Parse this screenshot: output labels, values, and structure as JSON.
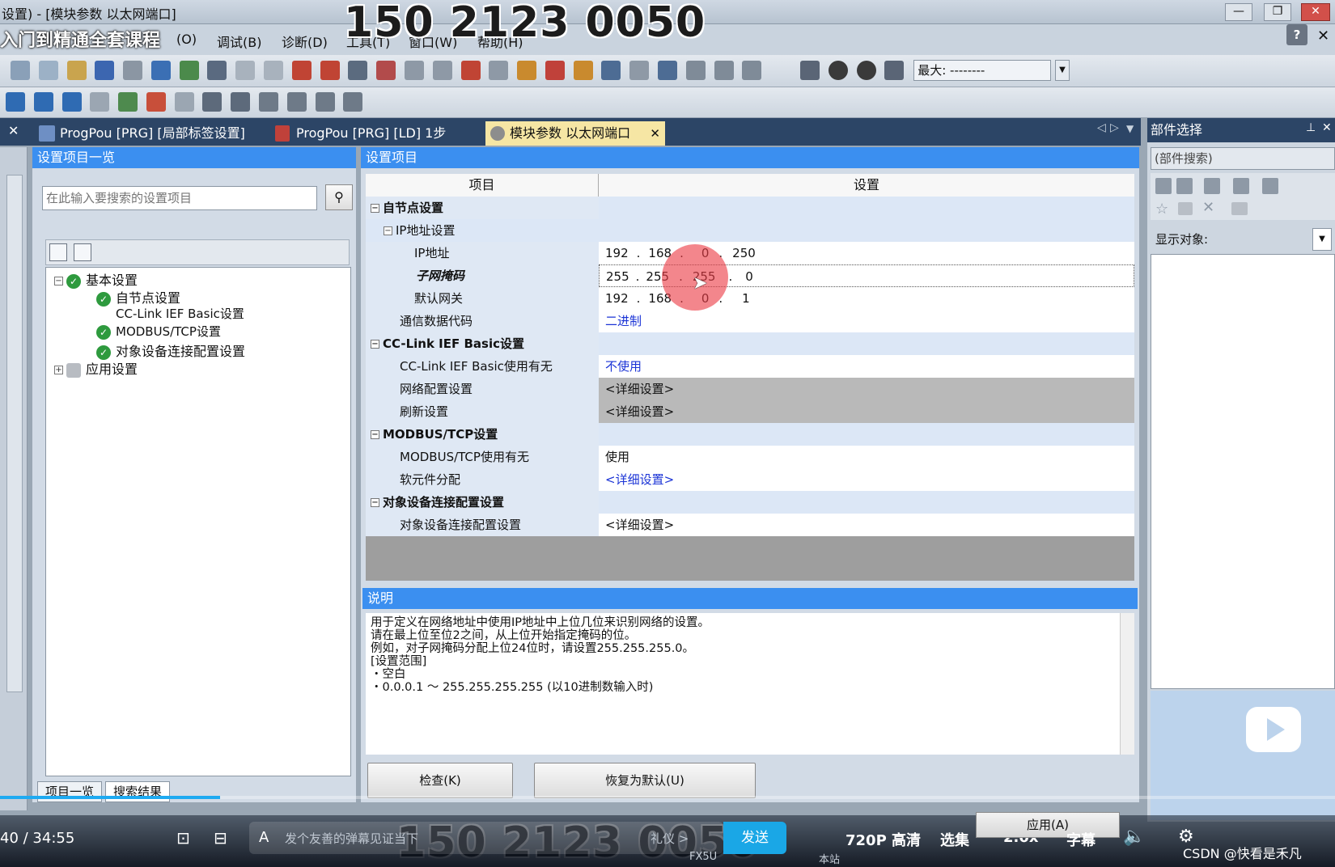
{
  "window": {
    "title": "设置) - [模块参数 以太网端口]",
    "course_overlay": "入门到精通全套课程",
    "watermark": "150 2123 0050"
  },
  "menu": {
    "items": [
      "(O)",
      "调试(B)",
      "诊断(D)",
      "工具(T)",
      "窗口(W)",
      "帮助(H)"
    ]
  },
  "toolbar": {
    "zoom_label": "最大: --------"
  },
  "tabs": [
    {
      "label": "ProgPou [PRG] [局部标签设置]"
    },
    {
      "label": "ProgPou [PRG] [LD] 1步"
    },
    {
      "label": "模块参数 以太网端口"
    }
  ],
  "left_panel": {
    "title": "设置项目一览",
    "search_placeholder": "在此输入要搜索的设置项目",
    "tree": {
      "basic": "基本设置",
      "self_node": "自节点设置",
      "cclink": "CC-Link IEF Basic设置",
      "modbus": "MODBUS/TCP设置",
      "target_conn": "对象设备连接配置设置",
      "app": "应用设置"
    },
    "bottom_tabs": [
      "项目一览",
      "搜索结果"
    ]
  },
  "settings": {
    "title": "设置项目",
    "col_item": "项目",
    "col_setting": "设置",
    "self_node_group": "自节点设置",
    "ip_group": "IP地址设置",
    "ip_label": "IP地址",
    "ip": [
      "192",
      "168",
      "0",
      "250"
    ],
    "subnet_label": "子网掩码",
    "subnet": [
      "255",
      "255",
      "255",
      "0"
    ],
    "gateway_label": "默认网关",
    "gateway": [
      "192",
      "168",
      "0",
      "1"
    ],
    "comm_code_label": "通信数据代码",
    "comm_code_value": "二进制",
    "cclink_group": "CC-Link IEF Basic设置",
    "cclink_use_label": "CC-Link IEF Basic使用有无",
    "cclink_use_value": "不使用",
    "net_config_label": "网络配置设置",
    "net_config_value": "<详细设置>",
    "refresh_label": "刷新设置",
    "refresh_value": "<详细设置>",
    "modbus_group": "MODBUS/TCP设置",
    "modbus_use_label": "MODBUS/TCP使用有无",
    "modbus_use_value": "使用",
    "device_assign_label": "软元件分配",
    "device_assign_value": "<详细设置>",
    "target_group": "对象设备连接配置设置",
    "target_label": "对象设备连接配置设置",
    "target_value": "<详细设置>"
  },
  "description": {
    "title": "说明",
    "text": "用于定义在网络地址中使用IP地址中上位几位来识别网络的设置。\n请在最上位至位2之间，从上位开始指定掩码的位。\n例如，对子网掩码分配上位24位时，请设置255.255.255.0。\n[设置范围]\n・空白\n・0.0.0.1 ～ 255.255.255.255 (以10进制数输入时)"
  },
  "buttons": {
    "check": "检查(K)",
    "restore": "恢复为默认(U)",
    "apply": "应用(A)"
  },
  "right_panel": {
    "title": "部件选择",
    "search": "(部件搜索)",
    "display_target": "显示对象:"
  },
  "player": {
    "time": "40 / 34:55",
    "danmaku_placeholder": "发个友善的弹幕见证当下",
    "gift": "礼仪 >",
    "send": "发送",
    "quality": "720P 高清",
    "episodes": "选集",
    "speed": "2.0x",
    "subtitle": "字幕",
    "status_fx5u": "FX5U",
    "status_local": "本站",
    "credit": "CSDN @快看是禾凡",
    "progress": 0.165
  }
}
